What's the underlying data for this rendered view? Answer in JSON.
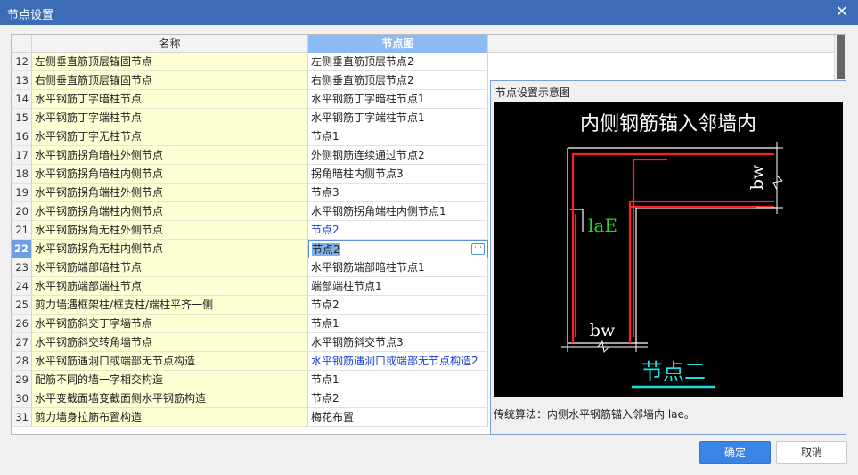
{
  "window": {
    "title": "节点设置",
    "close_glyph": "✕"
  },
  "grid": {
    "columns": {
      "name": "名称",
      "node": "节点图"
    },
    "rows": [
      {
        "num": "12",
        "name": "左侧垂直筋顶层锚固节点",
        "node": "左侧垂直筋顶层节点2"
      },
      {
        "num": "13",
        "name": "右侧垂直筋顶层锚固节点",
        "node": "右侧垂直筋顶层节点2"
      },
      {
        "num": "14",
        "name": "水平钢筋丁字暗柱节点",
        "node": "水平钢筋丁字暗柱节点1"
      },
      {
        "num": "15",
        "name": "水平钢筋丁字端柱节点",
        "node": "水平钢筋丁字端柱节点1"
      },
      {
        "num": "16",
        "name": "水平钢筋丁字无柱节点",
        "node": "节点1"
      },
      {
        "num": "17",
        "name": "水平钢筋拐角暗柱外侧节点",
        "node": "外侧钢筋连续通过节点2"
      },
      {
        "num": "18",
        "name": "水平钢筋拐角暗柱内侧节点",
        "node": "拐角暗柱内侧节点3"
      },
      {
        "num": "19",
        "name": "水平钢筋拐角端柱外侧节点",
        "node": "节点3"
      },
      {
        "num": "20",
        "name": "水平钢筋拐角端柱内侧节点",
        "node": "水平钢筋拐角端柱内侧节点1"
      },
      {
        "num": "21",
        "name": "水平钢筋拐角无柱外侧节点",
        "node": "节点2",
        "blue": true
      },
      {
        "num": "22",
        "name": "水平钢筋拐角无柱内侧节点",
        "node": "节点2",
        "selected": true
      },
      {
        "num": "23",
        "name": "水平钢筋端部暗柱节点",
        "node": "水平钢筋端部暗柱节点1"
      },
      {
        "num": "24",
        "name": "水平钢筋端部端柱节点",
        "node": "端部端柱节点1"
      },
      {
        "num": "25",
        "name": "剪力墙遇框架柱/框支柱/端柱平齐一侧",
        "node": "节点2"
      },
      {
        "num": "26",
        "name": "水平钢筋斜交丁字墙节点",
        "node": "节点1"
      },
      {
        "num": "27",
        "name": "水平钢筋斜交转角墙节点",
        "node": "水平钢筋斜交节点3"
      },
      {
        "num": "28",
        "name": "水平钢筋遇洞口或端部无节点构造",
        "node": "水平钢筋遇洞口或端部无节点构造2",
        "blue": true
      },
      {
        "num": "29",
        "name": "配筋不同的墙一字相交构造",
        "node": "节点1"
      },
      {
        "num": "30",
        "name": "水平变截面墙变截面侧水平钢筋构造",
        "node": "节点2"
      },
      {
        "num": "31",
        "name": "剪力墙身拉筋布置构造",
        "node": "梅花布置"
      }
    ],
    "ellipsis_label": "⋯"
  },
  "diagram": {
    "panel_title": "节点设置示意图",
    "heading": "内侧钢筋锚入邻墙内",
    "label_bw_top": "bw",
    "label_lae": "laE",
    "label_bw_bottom": "bw",
    "node_label": "节点二",
    "colors": {
      "rebar": "#ff2020",
      "wall": "#ffffff",
      "lae": "#19e019",
      "node_label": "#19e0e0",
      "background": "#000000"
    },
    "caption": "传统算法：内侧水平钢筋锚入邻墙内 lae。"
  },
  "buttons": {
    "ok": "确定",
    "cancel": "取消"
  }
}
